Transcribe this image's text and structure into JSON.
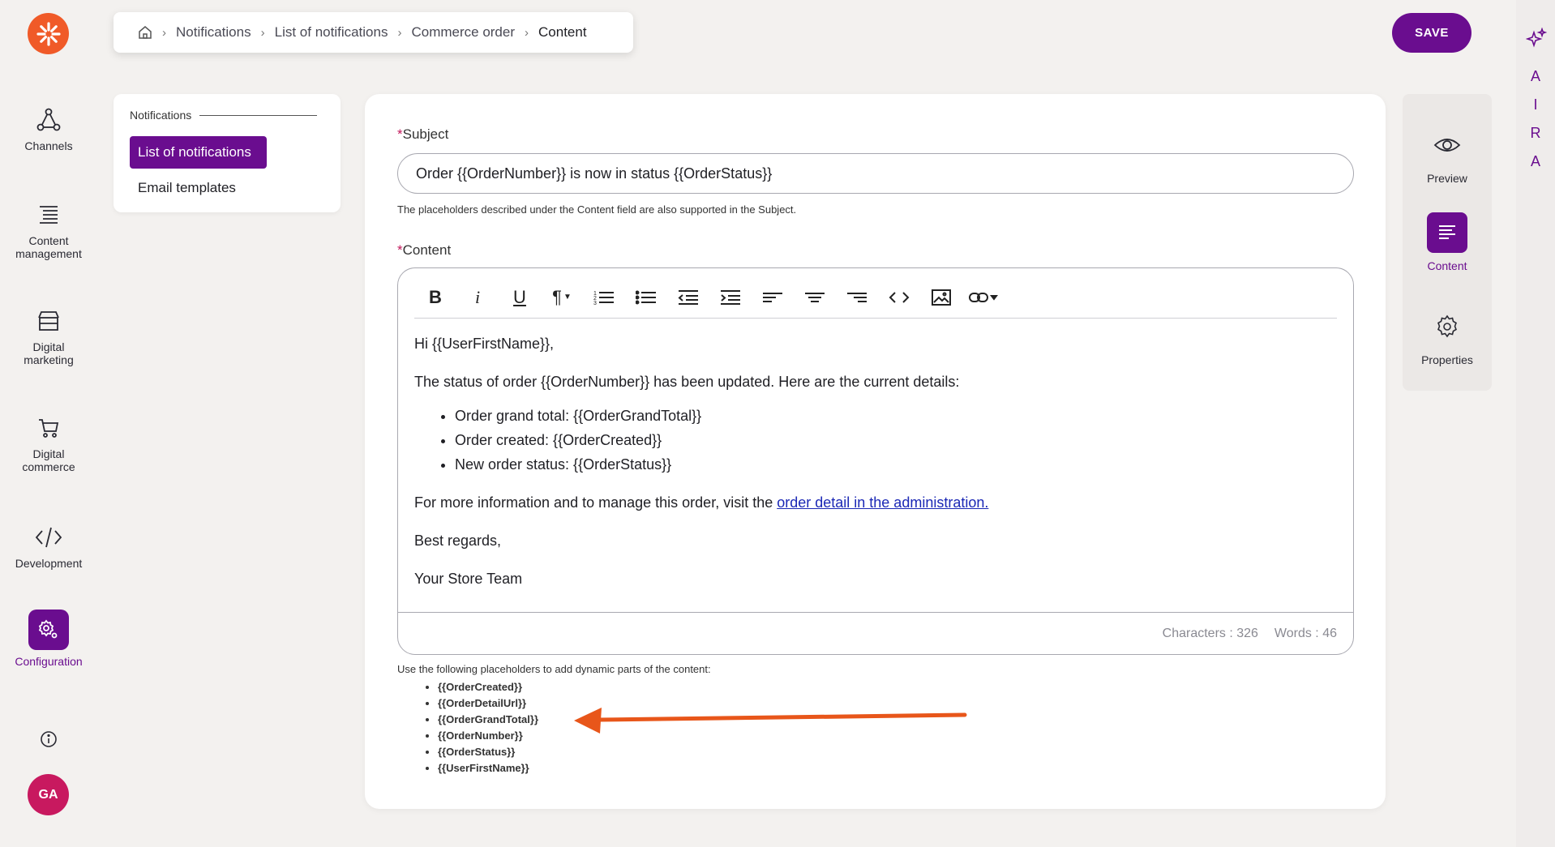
{
  "breadcrumb": {
    "home_icon": "home-icon",
    "items": [
      "Notifications",
      "List of notifications",
      "Commerce order"
    ],
    "current": "Content"
  },
  "header": {
    "save_label": "SAVE"
  },
  "aira": {
    "icon": "sparkles-icon",
    "letters": [
      "A",
      "I",
      "R",
      "A"
    ]
  },
  "leftnav": {
    "items": [
      {
        "label": "Channels",
        "icon": "channels-icon"
      },
      {
        "label": "Content management",
        "icon": "content-management-icon"
      },
      {
        "label": "Digital marketing",
        "icon": "digital-marketing-icon"
      },
      {
        "label": "Digital commerce",
        "icon": "cart-icon"
      },
      {
        "label": "Development",
        "icon": "code-icon"
      },
      {
        "label": "Configuration",
        "icon": "gear-icon",
        "active": true
      }
    ],
    "avatar_initials": "GA",
    "info_icon": "info-icon"
  },
  "subnav": {
    "heading": "Notifications",
    "active_item": "List of notifications",
    "item": "Email templates"
  },
  "form": {
    "subject_label": "Subject",
    "subject_value": "Order {{OrderNumber}} is now in status {{OrderStatus}}",
    "subject_hint": "The placeholders described under the Content field are also supported in the Subject.",
    "content_label": "Content"
  },
  "editor": {
    "toolbar": [
      "bold-icon",
      "italic-icon",
      "underline-icon",
      "paragraph-icon",
      "ordered-list-icon",
      "bullet-list-icon",
      "outdent-icon",
      "indent-icon",
      "align-left-icon",
      "align-center-icon",
      "align-right-icon",
      "code-icon",
      "image-icon",
      "link-icon"
    ],
    "greeting": "Hi {{UserFirstName}},",
    "intro": "The status of order {{OrderNumber}} has been updated. Here are the current details:",
    "bullets": [
      "Order grand total: {{OrderGrandTotal}}",
      "Order created: {{OrderCreated}}",
      "New order status: {{OrderStatus}}"
    ],
    "more_info_prefix": "For more information and to manage this order, visit the ",
    "more_info_link": "order detail in the administration.",
    "regards": "Best regards,",
    "signature": "Your Store Team",
    "characters": "Characters : 326",
    "words": "Words : 46"
  },
  "placeholders": {
    "help": "Use the following placeholders to add dynamic parts of the content:",
    "items": [
      "{{OrderCreated}}",
      "{{OrderDetailUrl}}",
      "{{OrderGrandTotal}}",
      "{{OrderNumber}}",
      "{{OrderStatus}}",
      "{{UserFirstName}}"
    ]
  },
  "annotation": {
    "color": "#e8561a"
  },
  "rightpanel": {
    "items": [
      {
        "label": "Preview",
        "icon": "eye-icon"
      },
      {
        "label": "Content",
        "icon": "content-icon",
        "active": true
      },
      {
        "label": "Properties",
        "icon": "gear-icon"
      }
    ]
  },
  "colors": {
    "brand": "#6a0d8f",
    "logo": "#f05a28",
    "avatar": "#c8195f",
    "link": "#1a27b5"
  }
}
